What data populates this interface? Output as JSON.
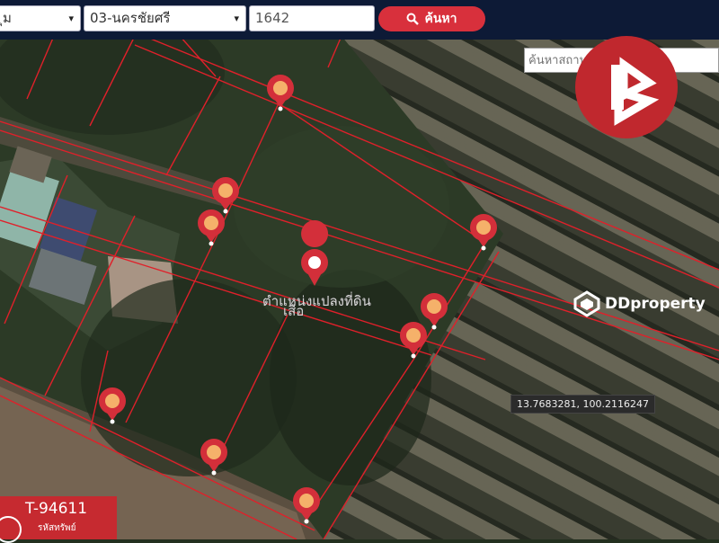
{
  "toolbar": {
    "province_value": "ุม",
    "district_value": "03-นครชัยศรี",
    "parcel_number": "1642",
    "search_label": "ค้นหา"
  },
  "map": {
    "place_search_placeholder": "ค้นหาสถานที่อื่",
    "parcel_label_line1": "ตำแหน่งแปลงที่ดิน",
    "parcel_label_line2": "เสือ",
    "coordinate_readout": "13.7683281, 100.2116247",
    "pin_color": "#d32f3a",
    "boundary_color": "#e0202a"
  },
  "watermark": {
    "brand": "DDproperty"
  },
  "badge": {
    "code": "T-94611",
    "caption": "รหัสทรัพย์",
    "color": "#c62a30"
  }
}
